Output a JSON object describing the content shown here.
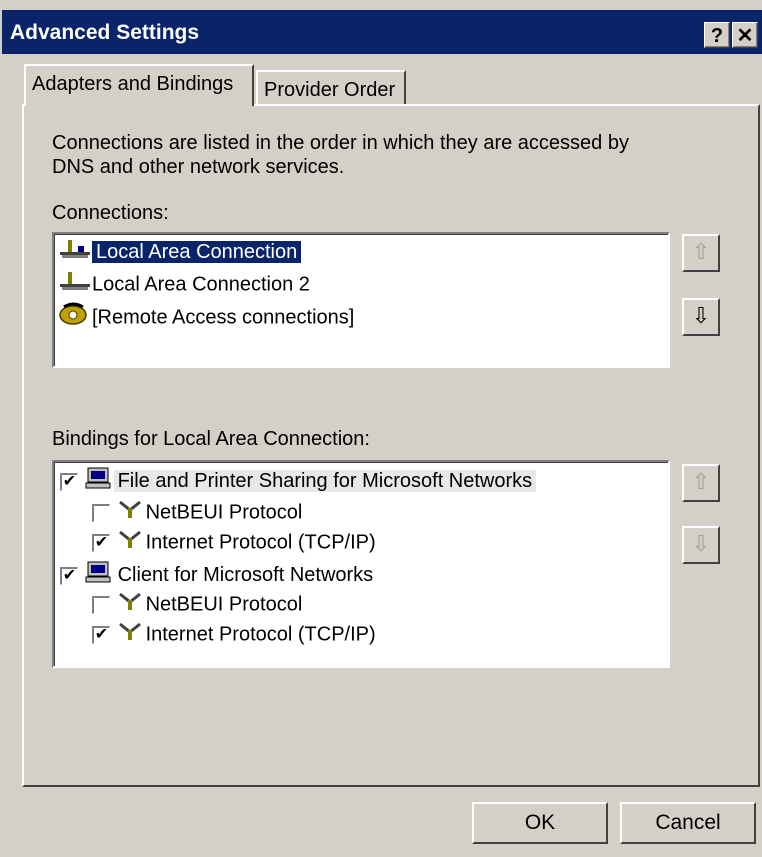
{
  "window": {
    "title": "Advanced Settings",
    "help_glyph": "?",
    "close_glyph": "✕"
  },
  "tabs": [
    {
      "label": "Adapters and Bindings",
      "active": true
    },
    {
      "label": "Provider Order",
      "active": false
    }
  ],
  "intro_text_line1": "Connections are listed in the order in which they are accessed by",
  "intro_text_line2": "DNS and other network services.",
  "connections": {
    "label": "Connections:",
    "items": [
      {
        "label": "Local Area Connection",
        "selected": true,
        "icon": "network-adapter-icon"
      },
      {
        "label": "Local Area Connection 2",
        "selected": false,
        "icon": "network-adapter-icon"
      },
      {
        "label": "[Remote Access connections]",
        "selected": false,
        "icon": "dialup-phone-icon"
      }
    ]
  },
  "bindings": {
    "label": "Bindings for Local Area Connection:",
    "items": [
      {
        "label": "File and Printer Sharing for Microsoft Networks",
        "checked": true,
        "level": 0,
        "icon": "computer-icon"
      },
      {
        "label": "NetBEUI Protocol",
        "checked": false,
        "level": 1,
        "icon": "protocol-icon"
      },
      {
        "label": "Internet Protocol (TCP/IP)",
        "checked": true,
        "level": 1,
        "icon": "protocol-icon"
      },
      {
        "label": "Client for Microsoft Networks",
        "checked": true,
        "level": 0,
        "icon": "computer-icon"
      },
      {
        "label": "NetBEUI Protocol",
        "checked": false,
        "level": 1,
        "icon": "protocol-icon"
      },
      {
        "label": "Internet Protocol (TCP/IP)",
        "checked": true,
        "level": 1,
        "icon": "protocol-icon"
      }
    ]
  },
  "arrows": {
    "up": "⇧",
    "down": "⇩"
  },
  "buttons": {
    "ok": "OK",
    "cancel": "Cancel"
  },
  "colors": {
    "titlebar": "#0a246a",
    "face": "#d4d0c8",
    "selection": "#0a246a"
  }
}
